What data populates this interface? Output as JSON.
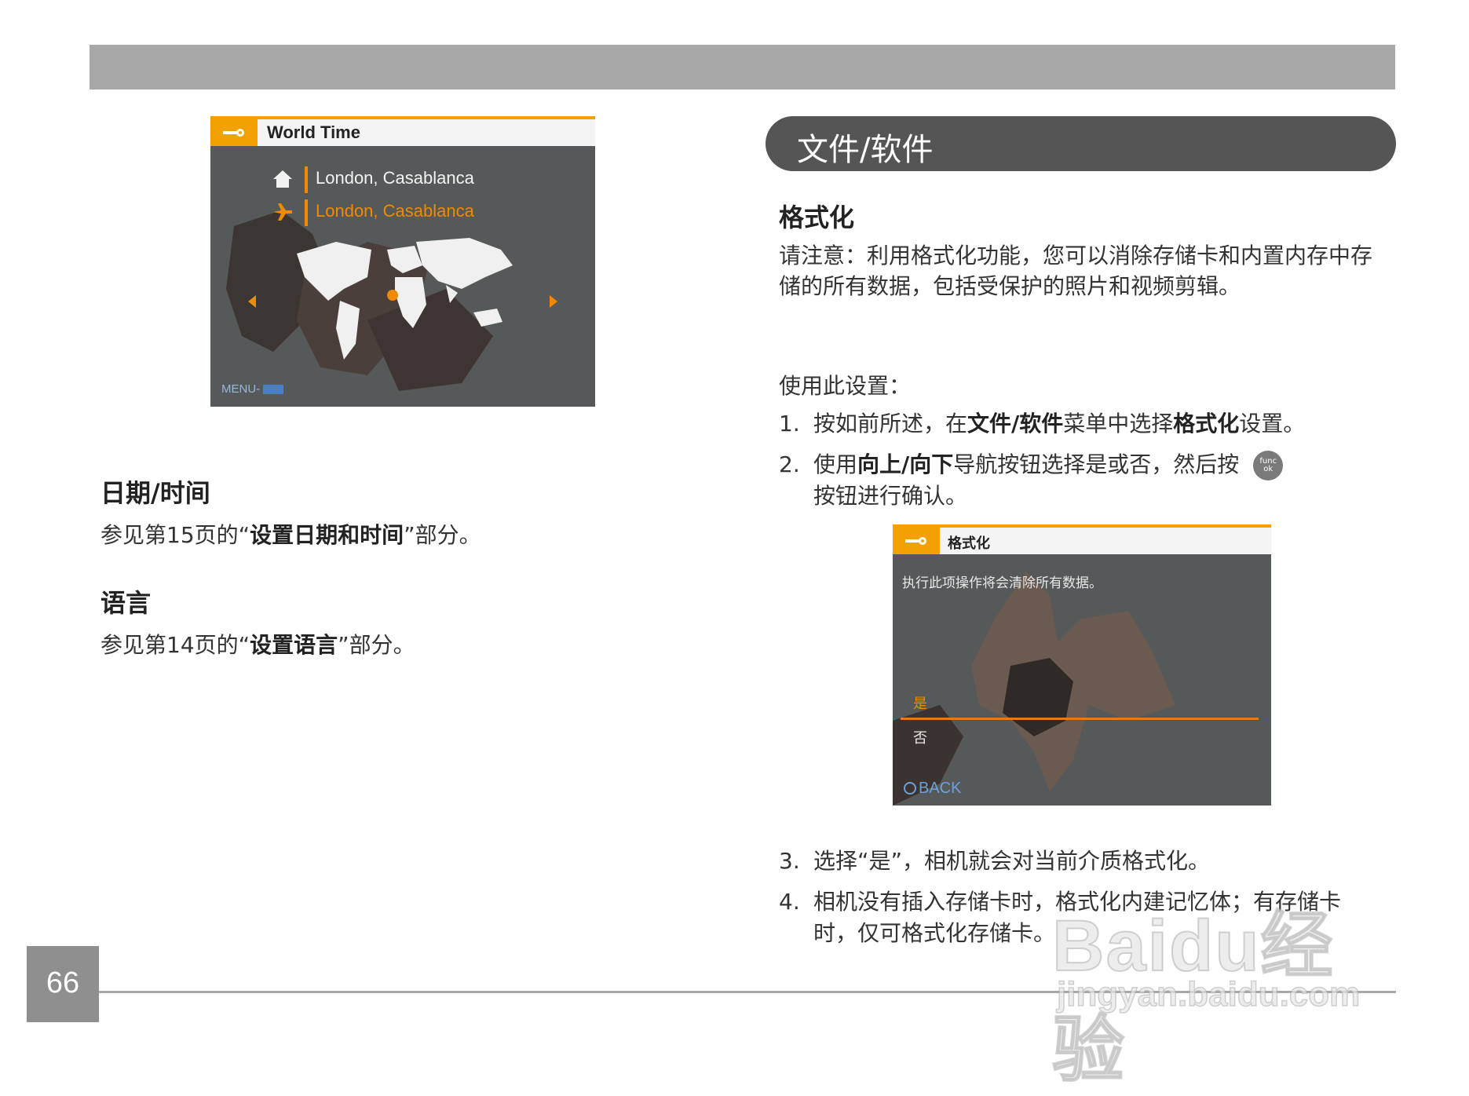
{
  "left_screenshot": {
    "title": "World Time",
    "home_city": "London, Casablanca",
    "travel_city": "London, Casablanca",
    "menu_hint": "MENU-"
  },
  "left": {
    "date_time": {
      "heading": "日期/时间",
      "text_before": "参见第15页的“",
      "text_bold": "设置日期和时间",
      "text_after": "”部分。"
    },
    "language": {
      "heading": "语言",
      "text_before": "参见第14页的“",
      "text_bold": "设置语言",
      "text_after": "”部分。"
    }
  },
  "right": {
    "section_title": "文件/软件",
    "format": {
      "heading": "格式化",
      "note": "请注意：利用格式化功能，您可以消除存储卡和内置内存中存储的所有数据，包括受保护的照片和视频剪辑。"
    },
    "usage_label": "使用此设置：",
    "steps": [
      {
        "num": "1.",
        "a": "按如前所述，在",
        "b1": "文件/软件",
        "c": "菜单中选择",
        "b2": "格式化",
        "d": "设置。"
      },
      {
        "num": "2.",
        "a": "使用",
        "b1": "向上/向下",
        "c": "导航按钮选择是或否，然后按",
        "d": "按钮进行确认。",
        "btn_top": "func",
        "btn_bottom": "ok"
      },
      {
        "num": "3.",
        "a": "选择“是”，相机就会对当前介质格式化。"
      },
      {
        "num": "4.",
        "a": "相机没有插入存储卡时，格式化内建记忆体；有存储卡时，仅可格式化存储卡。"
      }
    ]
  },
  "format_screenshot": {
    "title": "格式化",
    "warning": "执行此项操作将会清除所有数据。",
    "option_yes": "是",
    "option_no": "否",
    "back_label": "BACK"
  },
  "footer": {
    "page_number": "66"
  },
  "watermark": {
    "brand": "Baidu经验",
    "url": "jingyan.baidu.com"
  }
}
